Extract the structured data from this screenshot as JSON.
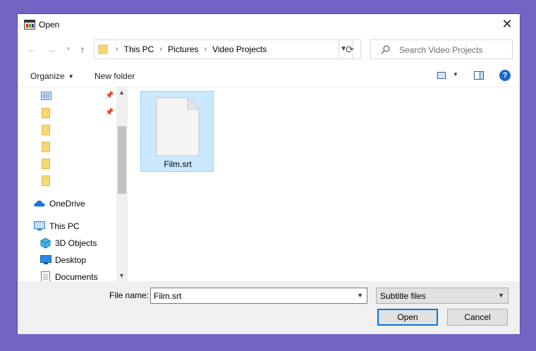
{
  "window": {
    "title": "Open"
  },
  "address": {
    "crumbs": [
      "This PC",
      "Pictures",
      "Video Projects"
    ]
  },
  "search": {
    "placeholder": "Search Video Projects"
  },
  "toolbar": {
    "organize_label": "Organize",
    "new_folder_label": "New folder"
  },
  "navpane": {
    "items": [
      {
        "label": "OneDrive"
      },
      {
        "label": "This PC"
      },
      {
        "label": "3D Objects"
      },
      {
        "label": "Desktop"
      },
      {
        "label": "Documents"
      }
    ]
  },
  "files": [
    {
      "name": "Film.srt"
    }
  ],
  "bottom": {
    "file_name_label": "File name:",
    "file_name_value": "Film.srt",
    "file_type_value": "Subtitle files",
    "open_label": "Open",
    "cancel_label": "Cancel"
  },
  "colors": {
    "background": "#7563c4",
    "selection": "#cce8ff",
    "accent": "#0078d7"
  }
}
